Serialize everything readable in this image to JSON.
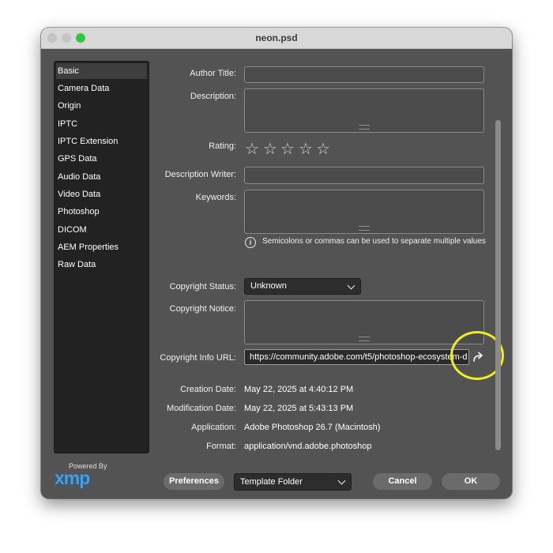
{
  "window": {
    "title": "neon.psd"
  },
  "sidebar": {
    "items": [
      {
        "label": "Basic",
        "selected": true
      },
      {
        "label": "Camera Data"
      },
      {
        "label": "Origin"
      },
      {
        "label": "IPTC"
      },
      {
        "label": "IPTC Extension"
      },
      {
        "label": "GPS Data"
      },
      {
        "label": "Audio Data"
      },
      {
        "label": "Video Data"
      },
      {
        "label": "Photoshop"
      },
      {
        "label": "DICOM"
      },
      {
        "label": "AEM Properties"
      },
      {
        "label": "Raw Data"
      }
    ]
  },
  "form": {
    "author_title": {
      "label": "Author Title:",
      "value": ""
    },
    "description": {
      "label": "Description:",
      "value": ""
    },
    "rating": {
      "label": "Rating:",
      "max": 5,
      "value": 0
    },
    "description_writer": {
      "label": "Description Writer:",
      "value": ""
    },
    "keywords": {
      "label": "Keywords:",
      "value": "",
      "hint": "Semicolons or commas can be used to separate multiple values"
    },
    "copyright_status": {
      "label": "Copyright Status:",
      "value": "Unknown"
    },
    "copyright_notice": {
      "label": "Copyright Notice:",
      "value": ""
    },
    "copyright_url": {
      "label": "Copyright Info URL:",
      "value": "https://community.adobe.com/t5/photoshop-ecosystem-d"
    },
    "creation_date": {
      "label": "Creation Date:",
      "value": "May 22, 2025 at 4:40:12 PM"
    },
    "modification_date": {
      "label": "Modification Date:",
      "value": "May 22, 2025 at 5:43:13 PM"
    },
    "application": {
      "label": "Application:",
      "value": "Adobe Photoshop 26.7 (Macintosh)"
    },
    "format": {
      "label": "Format:",
      "value": "application/vnd.adobe.photoshop"
    }
  },
  "footer": {
    "logo_caption": "Powered By",
    "logo_text": "xmp",
    "preferences_label": "Preferences",
    "template_select": "Template Folder",
    "cancel_label": "Cancel",
    "ok_label": "OK"
  },
  "colors": {
    "dialog_bg": "#535353",
    "xmp_logo": "#3aa0f0",
    "highlight_circle": "#eeee22",
    "close_button": "#2fc840"
  },
  "icons": [
    "info-icon",
    "share-arrow-icon",
    "chevron-down-icon",
    "star-icon"
  ]
}
